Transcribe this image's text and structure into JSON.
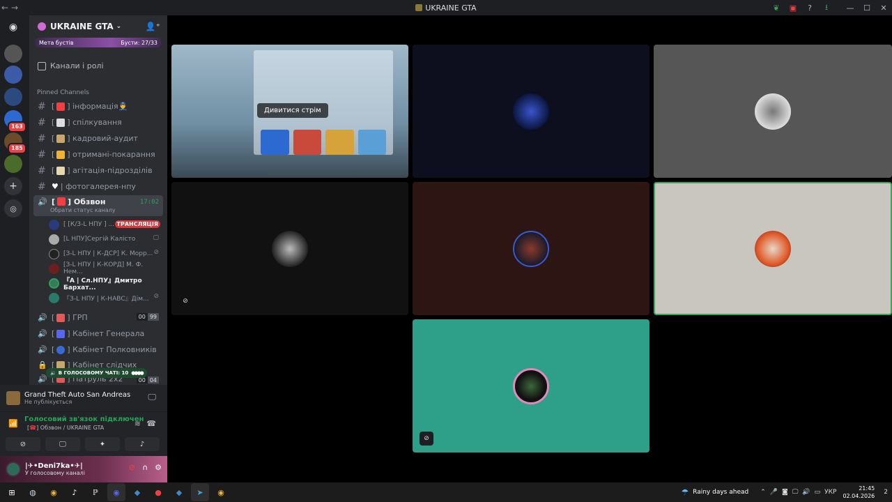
{
  "app": {
    "title": "UKRAINE GTA"
  },
  "titlebar_icons": [
    "leaf-icon",
    "inbox-icon",
    "help-icon",
    "download-icon",
    "minimize-icon",
    "maximize-icon",
    "close-icon"
  ],
  "server": {
    "name": "UKRAINE GTA",
    "boost_label": "Мета бустів",
    "boost_count": "Бусти: 27/33",
    "channels_roles": "Канали і ролі",
    "pinned_header": "Pinned Channels"
  },
  "server_badges": [
    "163",
    "185"
  ],
  "channels": [
    {
      "label": "інформація👮‍♂️",
      "prefix": "[",
      "suffix": "]"
    },
    {
      "label": "спілкування",
      "prefix": "[",
      "suffix": "]"
    },
    {
      "label": "кадровий-аудит",
      "prefix": "[",
      "suffix": "]"
    },
    {
      "label": "отримані-покарання",
      "prefix": "[",
      "suffix": "]"
    },
    {
      "label": "агітація-підрозділів",
      "prefix": "[",
      "suffix": "]"
    },
    {
      "label": "| фотогалерея-нпу",
      "prefix": "",
      "suffix": ""
    }
  ],
  "active_channel": {
    "label": "Обзвон",
    "prefix": "[",
    "suffix": "]",
    "sub": "Обрати статус каналу",
    "time": "17:02"
  },
  "members": [
    {
      "name": "[ [К/З-L НПУ ] ...",
      "live": "ТРАНСЛЯЦІЯ"
    },
    {
      "name": "[L НПУ]Сергій Калісто"
    },
    {
      "name": "[З-L НПУ | К-ДСР] К. Морр..."
    },
    {
      "name": "[З-L НПУ | К-КОРД] М. Ф. Нем..."
    },
    {
      "name": "『A | Сл.НПУ』Дмитро Бархат..."
    },
    {
      "name": "『З-L НПУ | К-НАВС』Дім..."
    }
  ],
  "voice_channels": [
    {
      "label": "ГРП",
      "prefix": "[",
      "suffix": "]",
      "counts": [
        "00",
        "99"
      ]
    },
    {
      "label": "Кабінет Генерала",
      "prefix": "[",
      "suffix": "]"
    },
    {
      "label": "Кабінет Полковників",
      "prefix": "[",
      "suffix": "]"
    },
    {
      "label": "Кабінет слідчих",
      "prefix": "[",
      "suffix": "]"
    },
    {
      "label": "Патруль 2х2",
      "prefix": "[",
      "suffix": "]",
      "counts": [
        "00",
        "04"
      ]
    }
  ],
  "vc_pill": "В ГОЛОСОВОМУ ЧАТІ: 10",
  "activity": {
    "title": "Grand Theft Auto San Andreas",
    "subtitle": "Не публікується"
  },
  "voice": {
    "status": "Голосовий зв'язок підключен",
    "channel": "Обзвон / UKRAINE GTA",
    "channel_prefix": "[",
    "channel_suffix": "]"
  },
  "user": {
    "name": "|✈•Deni7ka•✈|",
    "status": "У голосовому каналі"
  },
  "stream": {
    "watch_label": "Дивитися стрім"
  },
  "colors": {
    "accent_green": "#23a55a",
    "speaking_border": "#3ba55c",
    "teal_tile": "#2ea08a",
    "live_red": "#da373c"
  },
  "taskbar": {
    "weather": "Rainy days ahead",
    "lang": "УКР",
    "time": "21:45",
    "date": "02.04.2026",
    "notif": "2"
  }
}
